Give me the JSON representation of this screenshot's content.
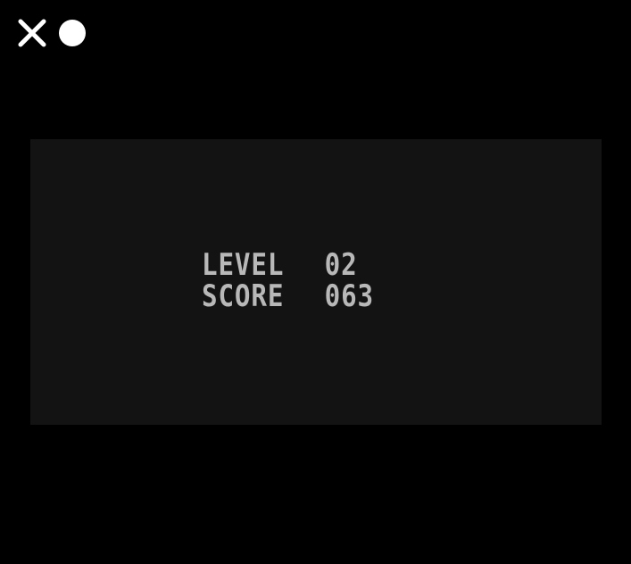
{
  "toolbar": {
    "close_icon": "close-icon",
    "record_icon": "record-icon"
  },
  "hud": {
    "level_label": "LEVEL",
    "level_value": "02",
    "score_label": "SCORE",
    "score_value": "063"
  },
  "colors": {
    "background": "#000000",
    "screen": "#131313",
    "text": "#b8b8b8",
    "icons": "#ffffff"
  }
}
